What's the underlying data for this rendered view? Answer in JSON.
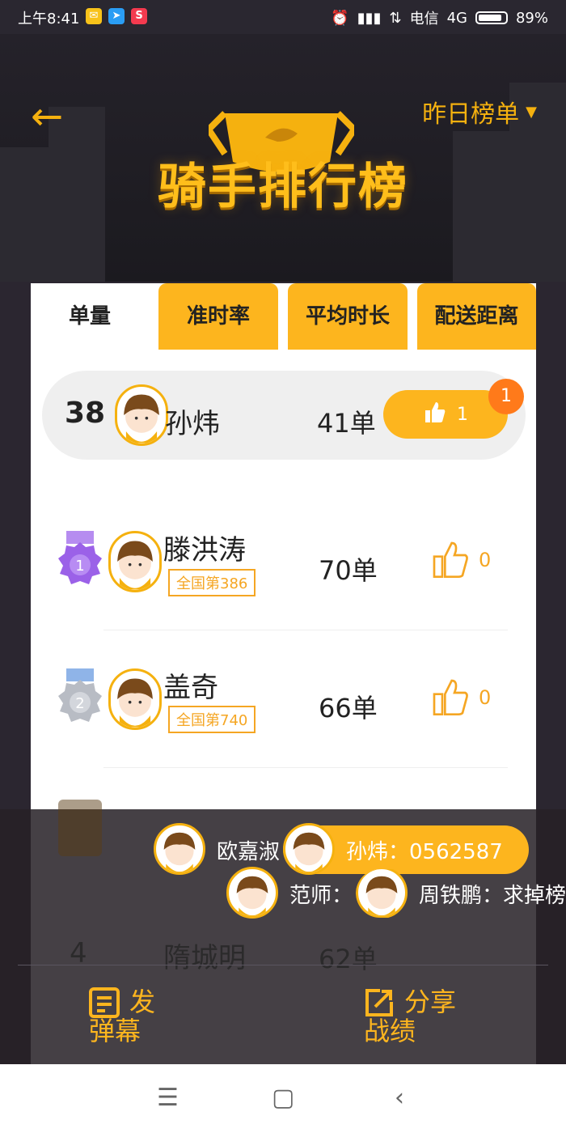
{
  "status_bar": {
    "time": "上午8:41",
    "carrier": "电信",
    "network": "4G",
    "battery": "89%",
    "battery_level": 0.89
  },
  "header": {
    "title": "骑手排行榜",
    "range_label": "昨日榜单"
  },
  "tabs": [
    {
      "label": "单量",
      "active": true
    },
    {
      "label": "准时率",
      "active": false
    },
    {
      "label": "平均时长",
      "active": false
    },
    {
      "label": "配送距离",
      "active": false
    }
  ],
  "my_entry": {
    "rank": "38",
    "name": "孙炜",
    "count": "41单",
    "likes": "1",
    "badge": "1"
  },
  "leaders": [
    {
      "medal": "1",
      "name": "滕洪涛",
      "national_rank": "全国第386",
      "count": "70单",
      "likes": "0"
    },
    {
      "medal": "2",
      "name": "盖奇",
      "national_rank": "全国第740",
      "count": "66单",
      "likes": "0"
    }
  ],
  "obscured": [
    {
      "rank": "4",
      "name": "隋城明",
      "count": "62单"
    }
  ],
  "danmaku": [
    {
      "text": "欧嘉淑",
      "style": "plain"
    },
    {
      "text": "孙炜：0562587",
      "style": "gold"
    },
    {
      "text": "范师：",
      "style": "plain"
    },
    {
      "text": "周铁鹏：求掉榜",
      "style": "plain"
    }
  ],
  "actions": {
    "danmaku": {
      "line1": "发",
      "line2": "弹幕"
    },
    "share": {
      "line1": "分享",
      "line2": "战绩"
    }
  },
  "colors": {
    "accent": "#fdb51e",
    "text_orange": "#f5a623",
    "dark_bg": "#2b2630"
  }
}
